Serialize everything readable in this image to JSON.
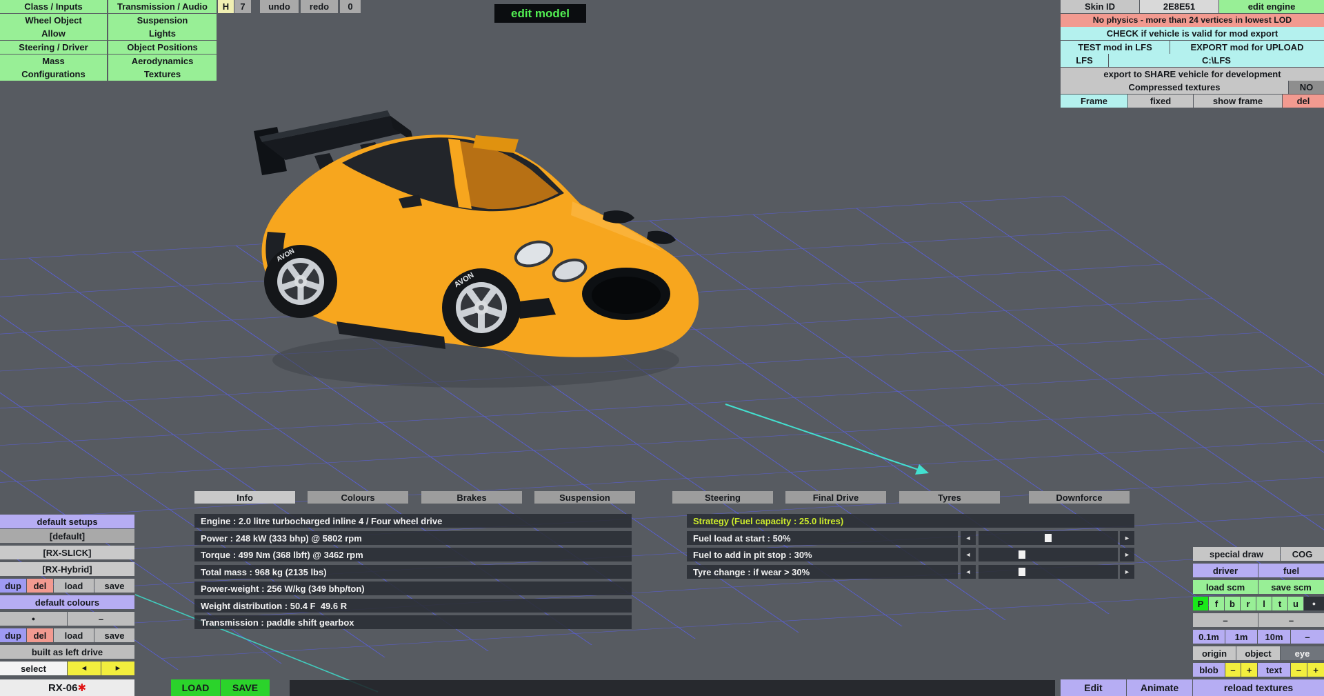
{
  "colors": {
    "accent_green": "#98ef96",
    "accent_cyan": "#b4f1ee",
    "accent_lavender": "#b6adf3",
    "warning_salmon": "#f29a90",
    "car_orange": "#f7a61e",
    "grid_blue": "#585ef0",
    "axis_cyan": "#43e0d0",
    "strategy_header_green": "#cdeb2d"
  },
  "left_menu": {
    "col1": [
      "Class / Inputs",
      "Wheel Object",
      "Allow",
      "Steering / Driver",
      "Mass",
      "Configurations"
    ],
    "col2": [
      "Transmission / Audio",
      "Suspension",
      "Lights",
      "Object Positions",
      "Aerodynamics",
      "Textures"
    ]
  },
  "history_bar": {
    "h_label": "H",
    "h_value": "7",
    "undo": "undo",
    "redo": "redo",
    "count": "0"
  },
  "edit_model_label": "edit model",
  "export_panel": {
    "skin_id_label": "Skin ID",
    "skin_id_value": "2E8E51",
    "edit_engine": "edit engine",
    "warning": "No physics - more than 24 vertices in lowest LOD",
    "check": "CHECK if vehicle is valid for mod export",
    "test": "TEST mod in LFS",
    "export": "EXPORT mod for UPLOAD",
    "lfs": "LFS",
    "lfs_path": "C:\\LFS",
    "share": "export to SHARE vehicle for development",
    "compressed_label": "Compressed textures",
    "compressed_value": "NO",
    "frame": "Frame",
    "fixed": "fixed",
    "show_frame": "show frame",
    "delete": "del"
  },
  "viewport": {
    "tyre_brand": "AVON"
  },
  "tabs": {
    "items": [
      "Info",
      "Colours",
      "Brakes",
      "Suspension",
      "Steering",
      "Final Drive",
      "Tyres",
      "Downforce"
    ],
    "active": "Info"
  },
  "info": {
    "rows": [
      "Engine : 2.0 litre turbocharged inline 4 / Four wheel drive",
      "Power : 248 kW (333 bhp) @ 5802 rpm",
      "Torque : 499 Nm (368 lbft) @ 3462 rpm",
      "Total mass : 968 kg (2135 lbs)",
      "Power-weight : 256 W/kg (349 bhp/ton)",
      "Weight distribution : 50.4 F  49.6 R",
      "Transmission : paddle shift gearbox"
    ]
  },
  "strategy": {
    "header": "Strategy (Fuel capacity : 25.0 litres)",
    "left_arrow": "◄",
    "right_arrow": "►",
    "rows": [
      {
        "label": "Fuel load at start : 50%",
        "percent": 50
      },
      {
        "label": "Fuel to add in pit stop : 30%",
        "percent": 30
      },
      {
        "label": "Tyre change : if wear > 30%",
        "percent": 30
      }
    ]
  },
  "setups_panel": {
    "header": "default setups",
    "items": [
      "[default]",
      "[RX-SLICK]",
      "[RX-Hybrid]"
    ],
    "dup": "dup",
    "delete": "del",
    "load": "load",
    "save": "save"
  },
  "colours_panel": {
    "header": "default colours",
    "dot": "●",
    "dash": "–",
    "dup": "dup",
    "delete": "del",
    "load": "load",
    "save": "save"
  },
  "drive_panel": {
    "built": "built as left drive",
    "select": "select",
    "prev": "◄",
    "next": "►"
  },
  "vehicle": {
    "name": "RX-06",
    "modified_mark": "✱",
    "load": "LOAD",
    "save": "SAVE"
  },
  "tools_panel": {
    "special_draw": "special draw",
    "cog": "COG",
    "driver": "driver",
    "fuel": "fuel",
    "load_scm": "load scm",
    "save_scm": "save scm",
    "layers": [
      "P",
      "f",
      "b",
      "r",
      "l",
      "t",
      "u",
      "●"
    ],
    "dash_left": "–",
    "dash_right": "–",
    "grid_sizes": [
      "0.1m",
      "1m",
      "10m",
      "–"
    ],
    "views": [
      "origin",
      "object",
      "eye"
    ],
    "blob": "blob",
    "text": "text",
    "minus": "–",
    "plus": "+",
    "edit": "Edit",
    "animate": "Animate",
    "reload_textures": "reload textures"
  }
}
